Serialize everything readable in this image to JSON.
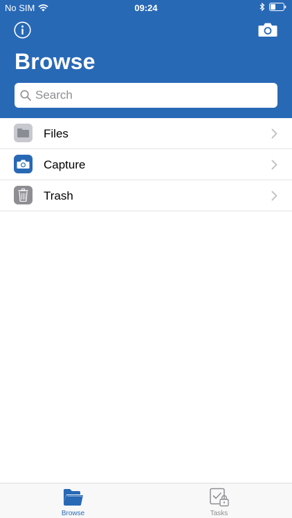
{
  "status_bar": {
    "carrier": "No SIM",
    "time": "09:24"
  },
  "header": {
    "title": "Browse",
    "info_icon": "info-icon",
    "camera_icon": "camera-icon"
  },
  "search": {
    "placeholder": "Search"
  },
  "list": {
    "items": [
      {
        "label": "Files",
        "icon": "folder-icon",
        "icon_bg": "#c7c9ce"
      },
      {
        "label": "Capture",
        "icon": "camera-icon",
        "icon_bg": "#2869b6"
      },
      {
        "label": "Trash",
        "icon": "trash-icon",
        "icon_bg": "#8e8e93"
      }
    ]
  },
  "tabbar": {
    "tabs": [
      {
        "label": "Browse",
        "icon": "folder-icon",
        "active": true
      },
      {
        "label": "Tasks",
        "icon": "tasks-lock-icon",
        "active": false
      }
    ]
  },
  "colors": {
    "brand": "#2869b6",
    "active_tab": "#2869b6",
    "inactive_tab": "#8e8e93"
  }
}
